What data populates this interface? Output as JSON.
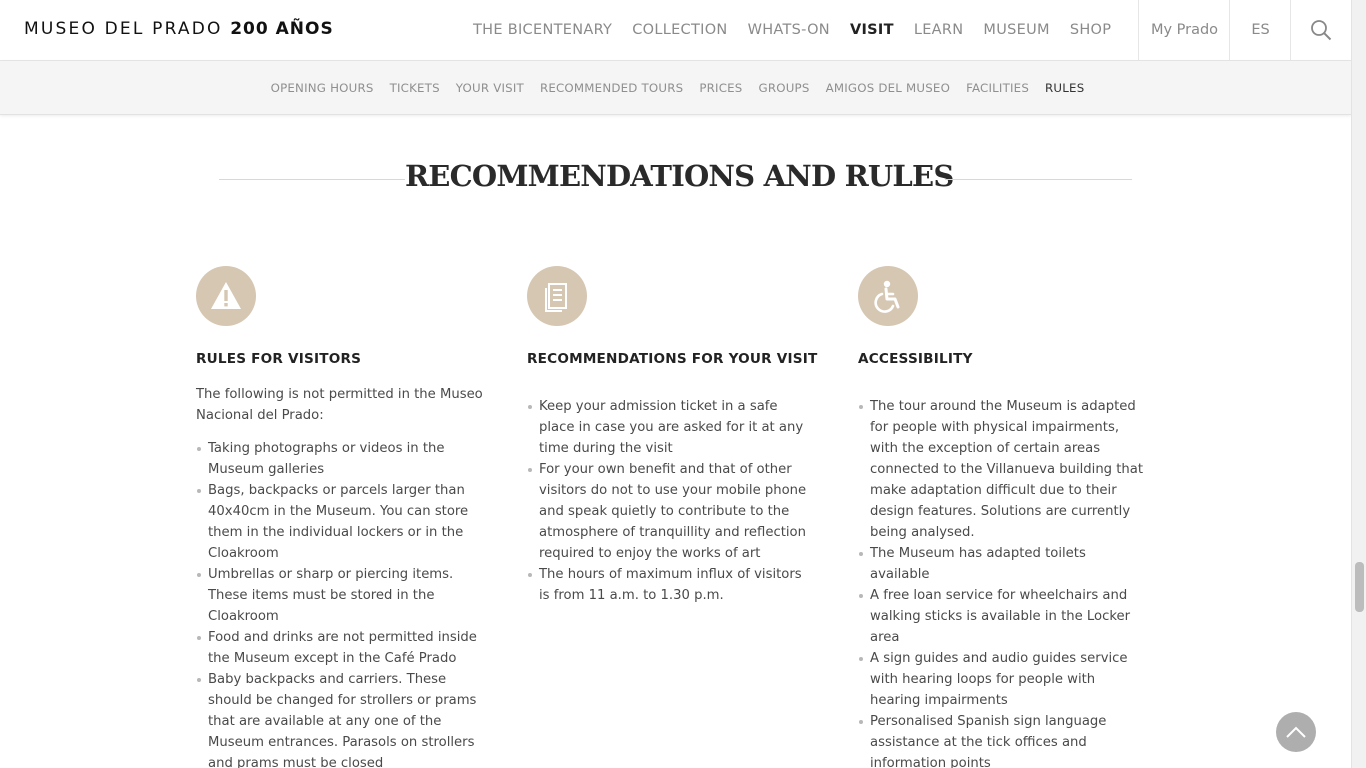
{
  "header": {
    "brand_name": "MUSEO DEL PRADO",
    "brand_suffix": "200 AÑOS",
    "nav_items": [
      {
        "label": "THE BICENTENARY",
        "active": false
      },
      {
        "label": "COLLECTION",
        "active": false
      },
      {
        "label": "WHATS-ON",
        "active": false
      },
      {
        "label": "VISIT",
        "active": true
      },
      {
        "label": "LEARN",
        "active": false
      },
      {
        "label": "MUSEUM",
        "active": false
      },
      {
        "label": "SHOP",
        "active": false
      }
    ],
    "my_prado": "My Prado",
    "language": "ES",
    "search_icon": "search-icon"
  },
  "subnav": {
    "items": [
      {
        "label": "OPENING HOURS",
        "active": false
      },
      {
        "label": "TICKETS",
        "active": false
      },
      {
        "label": "YOUR VISIT",
        "active": false
      },
      {
        "label": "RECOMMENDED TOURS",
        "active": false
      },
      {
        "label": "PRICES",
        "active": false
      },
      {
        "label": "GROUPS",
        "active": false
      },
      {
        "label": "AMIGOS DEL MUSEO",
        "active": false
      },
      {
        "label": "FACILITIES",
        "active": false
      },
      {
        "label": "RULES",
        "active": true
      }
    ]
  },
  "main": {
    "title": "RECOMMENDATIONS AND RULES",
    "columns": [
      {
        "icon": "warning-icon",
        "heading": "RULES FOR VISITORS",
        "intro": "The following is not permitted in the Museo Nacional del Prado:",
        "items": [
          "Taking photographs or videos in the Museum galleries",
          "Bags, backpacks or parcels larger than 40x40cm in the Museum. You can store them in the individual lockers or in the Cloakroom",
          "Umbrellas or sharp or piercing items. These items must be stored in the Cloakroom",
          "Food and drinks are not permitted inside the Museum except in the Café Prado",
          "Baby backpacks and carriers. These should be changed for strollers or prams that are available at any one of the Museum entrances. Parasols on strollers and prams must be closed"
        ]
      },
      {
        "icon": "document-icon",
        "heading": "RECOMMENDATIONS FOR YOUR VISIT",
        "items": [
          "Keep your admission ticket in a safe place in case you are asked for it at any time during the visit",
          "For your own benefit and that of other visitors do not to use your mobile phone and speak quietly to contribute to the atmosphere of tranquillity and reflection required to enjoy the works of art",
          "The hours of maximum influx of visitors is from 11 a.m. to 1.30 p.m."
        ]
      },
      {
        "icon": "wheelchair-icon",
        "heading": "ACCESSIBILITY",
        "items": [
          "The tour around the Museum is adapted for people with physical impairments, with the exception of certain areas connected to the Villanueva building that make adaptation difficult due to their design features. Solutions are currently being analysed.",
          "The Museum has adapted toilets available",
          "A free loan service for wheelchairs and walking sticks is available in the Locker area",
          "A sign guides and audio guides service with hearing loops for people with hearing impairments",
          "Personalised Spanish sign language assistance at the tick offices and information points"
        ]
      }
    ]
  },
  "colors": {
    "icon_circle": "#d6c7b3",
    "nav_text": "#8a8a8a",
    "active_text": "#222222",
    "to_top_button": "#aeaeae"
  },
  "to_top_icon": "chevron-up-icon"
}
